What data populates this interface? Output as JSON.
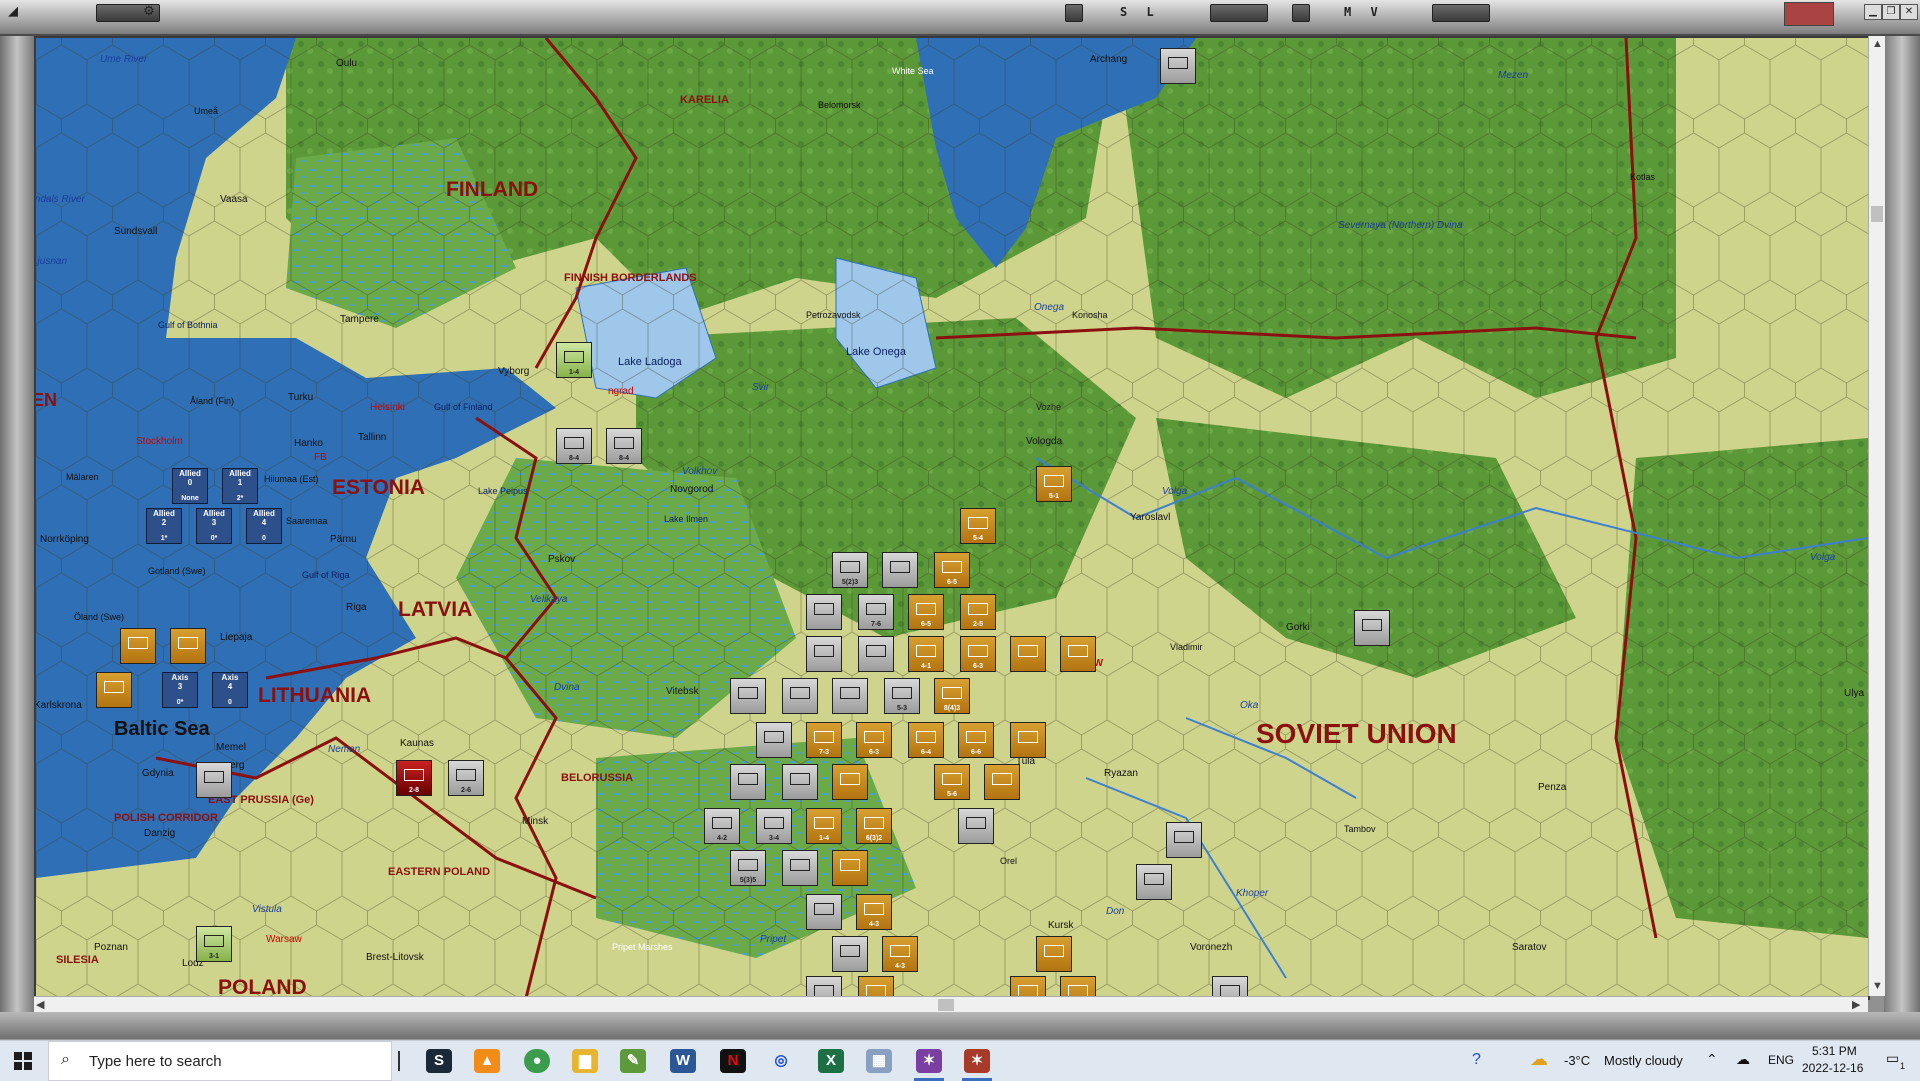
{
  "titlebar": {
    "panel_sl": "S L",
    "panel_mv": "M V"
  },
  "map": {
    "regions": {
      "finland": "FINLAND",
      "estonia": "ESTONIA",
      "latvia": "LATVIA",
      "lithuania": "LITHUANIA",
      "soviet_union": "SOVIET UNION",
      "poland": "POLAND",
      "baltic_sea": "Baltic Sea",
      "karelia": "KARELIA",
      "finnish_borderlands": "FINNISH BORDERLANDS",
      "belorussia": "BELORUSSIA",
      "eastern_poland": "EASTERN POLAND",
      "east_prussia": "EAST PRUSSIA (Ge)",
      "polish_corridor": "POLISH CORRIDOR",
      "silesia": "SILESIA",
      "sweden_edge": "EN"
    },
    "water": {
      "white_sea": "White Sea",
      "gulf_of_bothnia": "Gulf of Bothnia",
      "gulf_of_finland": "Gulf of Finland",
      "gulf_of_riga": "Gulf of Riga",
      "lake_ladoga": "Lake Ladoga",
      "lake_onega": "Lake Onega",
      "lake_peipus": "Lake Peipus",
      "lake_ilmen": "Lake Ilmen",
      "vozhe": "Vozhe",
      "pripet_marshes": "Pripet Marshes"
    },
    "rivers": [
      "Ume River",
      "Indals River",
      "Ljusnan",
      "Svir",
      "Volkhov",
      "Onega",
      "Volga",
      "Velikaya",
      "Dvina",
      "Neman",
      "Oka",
      "Don",
      "Khoper",
      "Vistula",
      "Pripet",
      "Mezen",
      "Severnaya (Northern) Dvina",
      "Volga"
    ],
    "cities": [
      "Oulu",
      "Umeå",
      "Vaasa",
      "Sundsvall",
      "Tampere",
      "Turku",
      "Åland (Fin)",
      "Helsinki",
      "Vyborg",
      "ngrad",
      "Hanko",
      "FB",
      "Tallinn",
      "Stockholm",
      "Mälaren",
      "Hiiumaa (Est)",
      "Saaremaa",
      "Pärnu",
      "Norrköping",
      "Gotland (Swe)",
      "Öland (Swe)",
      "Riga",
      "Liepaja",
      "Karlskrona",
      "Memel",
      "Kaunas",
      "Gdynia",
      "Danzig",
      "erg",
      "Minsk",
      "Pskov",
      "Novgorod",
      "Vitebsk",
      "Belomorsk",
      "Petrozavodsk",
      "Konosha",
      "Archang",
      "Vologda",
      "Yaroslavl",
      "Kotlas",
      "Gorki",
      "Vladimir",
      "SCOW",
      "Tula",
      "Ryazan",
      "Penza",
      "Tambov",
      "Orel",
      "Kursk",
      "Voronezh",
      "Saratov",
      "Ulya",
      "Warsaw",
      "Brest-Litovsk",
      "Poznan",
      "Lodz",
      "mel",
      "sk"
    ],
    "naval_boxes": [
      {
        "side": "Allied",
        "a": "0",
        "b": "None"
      },
      {
        "side": "Allied",
        "a": "1",
        "b": "2*"
      },
      {
        "side": "Allied",
        "a": "2",
        "b": "1*"
      },
      {
        "side": "Allied",
        "a": "3",
        "b": "0*"
      },
      {
        "side": "Allied",
        "a": "4",
        "b": "0"
      },
      {
        "side": "Axis",
        "a": "3",
        "b": "0*"
      },
      {
        "side": "Axis",
        "a": "4",
        "b": "0"
      }
    ],
    "unit_values": [
      "1-4",
      "8-4",
      "8-4",
      "5-1",
      "5-4",
      "5(2)3",
      "6-5",
      "2-5",
      "7-6",
      "4-1",
      "6-3",
      "5-3",
      "8(4)3",
      "7-3",
      "6-4",
      "6-6",
      "5-6",
      "4-2",
      "3-4",
      "1-4",
      "6(3)2",
      "5(3)5",
      "4-3",
      "2-6",
      "3-1",
      "2-8"
    ]
  },
  "taskbar": {
    "search_placeholder": "Type here to search",
    "weather_temp": "-3°C",
    "weather_desc": "Mostly cloudy",
    "lang": "ENG",
    "time": "5:31 PM",
    "date": "2022-12-16",
    "notif_count": "1"
  },
  "colors": {
    "sea": "#2f6fb5",
    "land_light": "#c9cf86",
    "land_forest": "#5f9c3c",
    "border": "#8b1010"
  }
}
